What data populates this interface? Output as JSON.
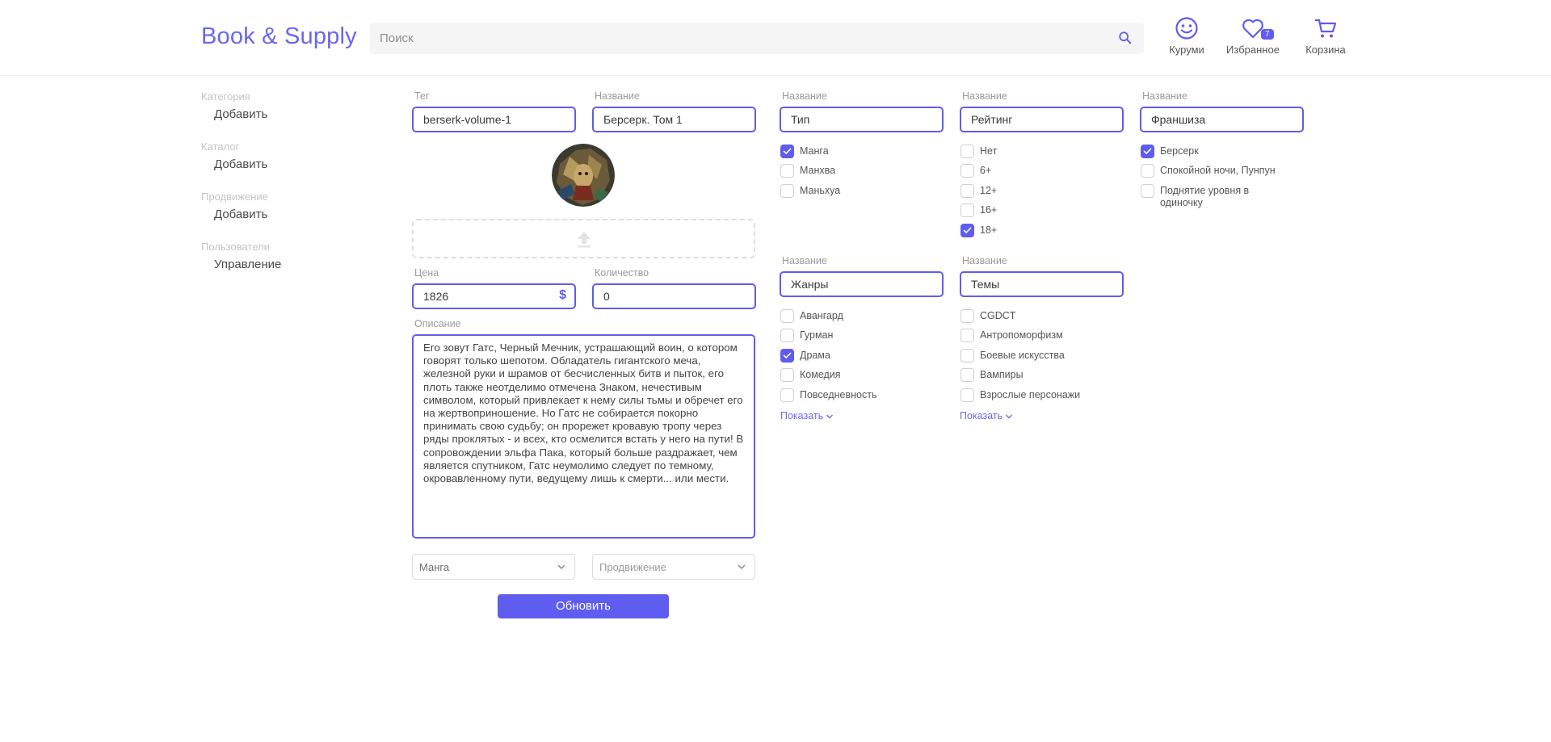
{
  "header": {
    "logo": "Book & Supply",
    "search_placeholder": "Поиск",
    "profile_label": "Куруми",
    "favorites_label": "Избранное",
    "favorites_count": "7",
    "cart_label": "Корзина"
  },
  "sidebar": [
    {
      "category": "Категория",
      "link": "Добавить"
    },
    {
      "category": "Каталог",
      "link": "Добавить"
    },
    {
      "category": "Продвижение",
      "link": "Добавить"
    },
    {
      "category": "Пользователи",
      "link": "Управление"
    }
  ],
  "form": {
    "tag_label": "Тег",
    "tag_value": "berserk-volume-1",
    "name_label": "Название",
    "name_value": "Берсерк. Том 1",
    "price_label": "Цена",
    "price_value": "1826",
    "currency_symbol": "$",
    "quantity_label": "Количество",
    "quantity_value": "0",
    "description_label": "Описание",
    "description_value": "Его зовут Гатс, Черный Мечник, устрашающий воин, о котором говорят только шепотом. Обладатель гигантского меча, железной руки и шрамов от бесчисленных битв и пыток, его плоть также неотделимо отмечена Знаком, нечестивым символом, который привлекает к нему силы тьмы и обречет его на жертвоприношение. Но Гатс не собирается покорно принимать свою судьбу; он прорежет кровавую тропу через ряды проклятых - и всех, кто осмелится встать у него на пути! В сопровождении эльфа Пака, который больше раздражает, чем является спутником, Гатс неумолимо следует по темному, окровавленному пути, ведущему лишь к смерти... или мести.",
    "category_select": "Манга",
    "promotion_select": "Продвижение",
    "submit_label": "Обновить"
  },
  "filters": {
    "type": {
      "label": "Название",
      "value": "Тип",
      "items": [
        {
          "t": "Манга",
          "on": true
        },
        {
          "t": "Манхва",
          "on": false
        },
        {
          "t": "Маньхуа",
          "on": false
        }
      ]
    },
    "rating": {
      "label": "Название",
      "value": "Рейтинг",
      "items": [
        {
          "t": "Нет",
          "on": false
        },
        {
          "t": "6+",
          "on": false
        },
        {
          "t": "12+",
          "on": false
        },
        {
          "t": "16+",
          "on": false
        },
        {
          "t": "18+",
          "on": true
        }
      ]
    },
    "franchise": {
      "label": "Название",
      "value": "Франшиза",
      "items": [
        {
          "t": "Берсерк",
          "on": true
        },
        {
          "t": "Спокойной ночи, Пунпун",
          "on": false
        },
        {
          "t": "Поднятие уровня в одиночку",
          "on": false
        }
      ]
    },
    "genres": {
      "label": "Название",
      "value": "Жанры",
      "show_more": "Показать",
      "items": [
        {
          "t": "Авангард",
          "on": false
        },
        {
          "t": "Гурман",
          "on": false
        },
        {
          "t": "Драма",
          "on": true
        },
        {
          "t": "Комедия",
          "on": false
        },
        {
          "t": "Повседневность",
          "on": false
        }
      ]
    },
    "themes": {
      "label": "Название",
      "value": "Темы",
      "show_more": "Показать",
      "items": [
        {
          "t": "CGDCT",
          "on": false
        },
        {
          "t": "Антропоморфизм",
          "on": false
        },
        {
          "t": "Боевые искусства",
          "on": false
        },
        {
          "t": "Вампиры",
          "on": false
        },
        {
          "t": "Взрослые персонажи",
          "on": false
        }
      ]
    }
  },
  "colors": {
    "accent": "#5f5cf0"
  }
}
